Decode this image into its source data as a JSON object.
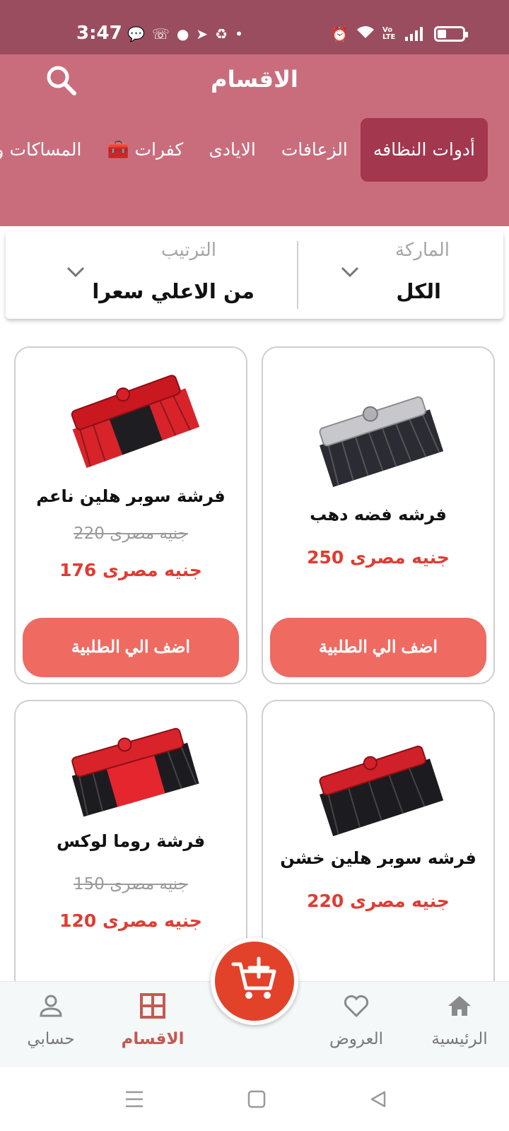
{
  "status_bar": {
    "time": "3:47",
    "left_icons": [
      "chat-icon",
      "missed-call-icon",
      "messenger-icon",
      "telegram-icon",
      "sync-icon",
      "dot-icon"
    ],
    "right_icons": [
      "alarm-icon",
      "wifi-icon",
      "volte-icon",
      "signal-icon",
      "battery-icon"
    ],
    "volte": "Vo LTE"
  },
  "header": {
    "title": "الاقسام",
    "search_icon": "search-icon",
    "background": "#c96d7d"
  },
  "tabs": [
    {
      "label": "أدوات النظافه",
      "active": true
    },
    {
      "label": "الزعافات",
      "active": false
    },
    {
      "label": "الايادى",
      "active": false
    },
    {
      "label": "كفرات 🧰",
      "active": false
    },
    {
      "label": "المساكات و",
      "active": false
    }
  ],
  "filters": {
    "brand": {
      "label": "الماركة",
      "value": "الكل"
    },
    "sort": {
      "label": "الترتيب",
      "value": "من الاعلي سعرا"
    }
  },
  "products": [
    {
      "name": "فرشه فضه دهب",
      "old_price": "",
      "price": "250 جنيه مصرى",
      "button": "اضف الي الطلبية",
      "image": "silver-black-broom-head"
    },
    {
      "name": "فرشة سوبر هلين ناعم",
      "old_price": "220 جنيه مصرى",
      "price": "176 جنيه مصرى",
      "button": "اضف الي الطلبية",
      "image": "red-black-broom-head"
    },
    {
      "name": "فرشه سوبر هلين خشن",
      "old_price": "",
      "price": "220 جنيه مصرى",
      "image": "red-black-broom-head"
    },
    {
      "name": "فرشة روما لوكس",
      "old_price": "150 جنيه مصرى",
      "price": "120 جنيه مصرى",
      "image": "red-black-broom-head"
    }
  ],
  "bottom_nav": [
    {
      "label": "الرئيسية",
      "icon": "home-icon",
      "active": false
    },
    {
      "label": "العروض",
      "icon": "heart-icon",
      "active": false
    },
    {
      "label": "الاقسام",
      "icon": "grid-icon",
      "active": true
    },
    {
      "label": "حسابي",
      "icon": "person-icon",
      "active": false
    }
  ],
  "fab": {
    "icon": "add-to-cart-icon"
  },
  "colors": {
    "status_bar": "#9a4d5e",
    "header": "#c96d7d",
    "active_tab": "#a2374e",
    "price": "#e03c31",
    "button": "#ef6a61",
    "fab": "#e2422a"
  },
  "system_nav": [
    "menu-icon",
    "home-square-icon",
    "back-triangle-icon"
  ]
}
